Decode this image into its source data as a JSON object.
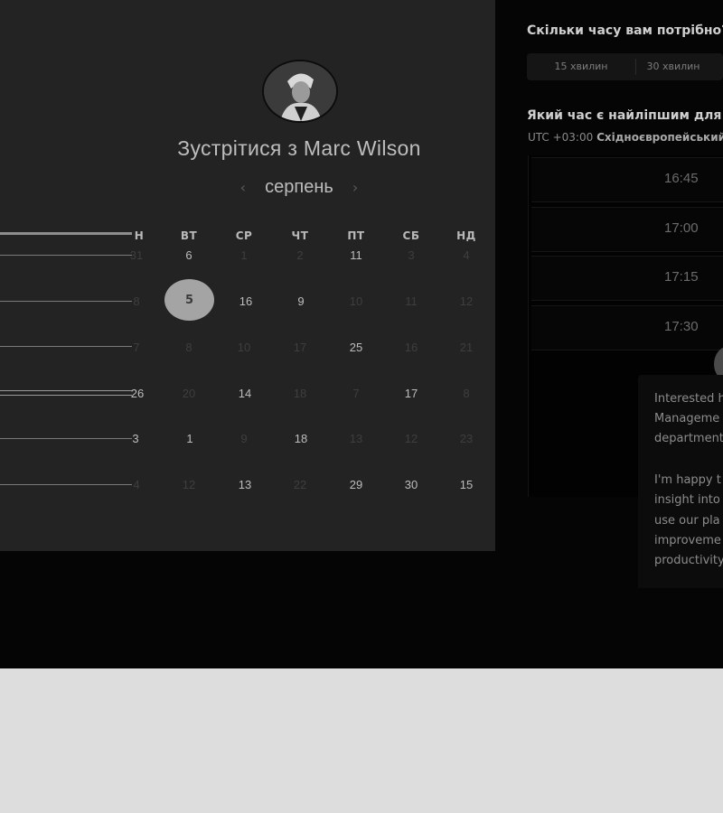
{
  "header": {
    "title": "Зустрітися з Marc Wilson"
  },
  "calendar": {
    "month": "серпень",
    "prev_icon": "chevron-left",
    "next_icon": "chevron-right",
    "weekdays": [
      "Н",
      "ВТ",
      "СР",
      "ЧТ",
      "ПТ",
      "СБ",
      "НД"
    ],
    "rows": [
      [
        "31",
        "6",
        "1",
        "2",
        "11",
        "3",
        "4"
      ],
      [
        "8",
        "5",
        "16",
        "9",
        "10",
        "11",
        "12"
      ],
      [
        "7",
        "8",
        "10",
        "17",
        "25",
        "16",
        "21"
      ],
      [
        "26",
        "20",
        "14",
        "18",
        "7",
        "17",
        "8"
      ],
      [
        "3",
        "1",
        "9",
        "18",
        "13",
        "12",
        "23"
      ],
      [
        "4",
        "12",
        "13",
        "22",
        "29",
        "30",
        "15"
      ]
    ],
    "selected_day": "5"
  },
  "duration": {
    "question": "Скільки часу вам потрібно?",
    "options": [
      "15 хвилин",
      "30 хвилин"
    ]
  },
  "time_slots": {
    "question": "Який час є найліпшим для вас?",
    "timezone_offset": "UTC +03:00",
    "timezone_name": "Східноєвропейський час",
    "slots": [
      "16:45",
      "17:00",
      "17:15",
      "17:30"
    ]
  },
  "popup": {
    "lines": [
      "Interested h",
      "Manageme",
      "department",
      "",
      "I'm happy t",
      "insight into",
      "use our pla",
      "improveme",
      "productivity"
    ]
  },
  "colors": {
    "panel_left": "#232323",
    "panel_right": "#050505",
    "selected_day_bg": "#a4a4a4",
    "page_bg": "#dddddd"
  }
}
